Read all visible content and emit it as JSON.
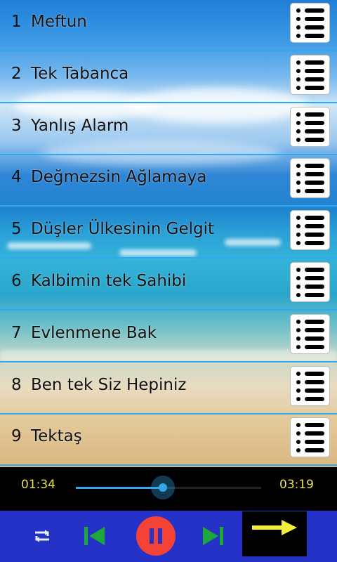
{
  "playlist": [
    {
      "num": "1",
      "title": "Meftun"
    },
    {
      "num": "2",
      "title": "Tek Tabanca"
    },
    {
      "num": "3",
      "title": "Yanlış Alarm"
    },
    {
      "num": "4",
      "title": "Değmezsin Ağlamaya"
    },
    {
      "num": "5",
      "title": "Düşler Ülkesinin Gelgit"
    },
    {
      "num": "6",
      "title": "Kalbimin tek Sahibi"
    },
    {
      "num": "7",
      "title": "Evlenmene Bak"
    },
    {
      "num": "8",
      "title": "Ben tek Siz Hepiniz"
    },
    {
      "num": "9",
      "title": "Tektaş"
    }
  ],
  "player": {
    "elapsed": "01:34",
    "duration": "03:19",
    "progress_fraction": 0.47
  },
  "colors": {
    "accent": "#34a7e8",
    "time_text": "#e7e24a",
    "controls_bg": "#2532c8",
    "pause_button": "#f44336",
    "prev_next": "#1fa83a",
    "forward_arrow": "#f2ee3a"
  },
  "icons": {
    "row_menu": "list-menu-icon",
    "repeat": "repeat-icon",
    "previous": "skip-previous-icon",
    "pause": "pause-icon",
    "next": "skip-next-icon",
    "forward": "arrow-right-icon"
  }
}
